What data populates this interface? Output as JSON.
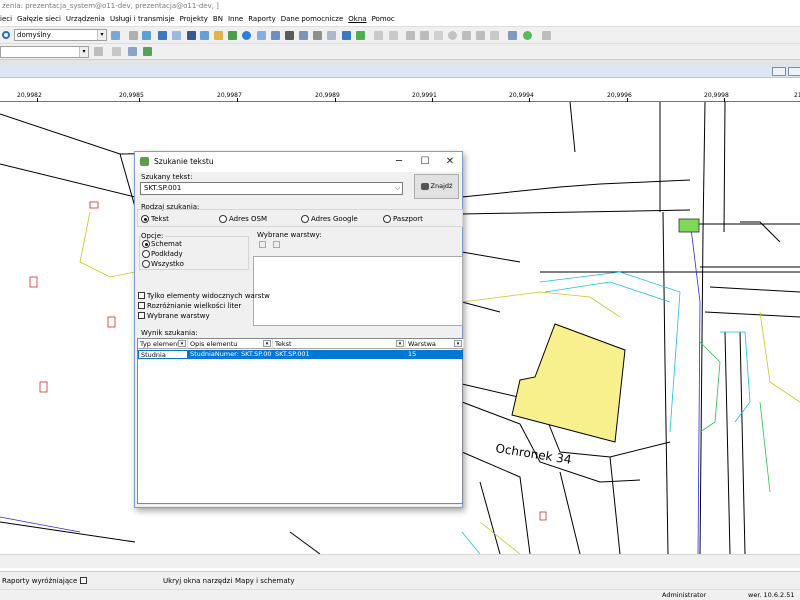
{
  "window": {
    "title": "zenia: prezentacja_system@o11-dev, prezentacja@o11-dev, ]"
  },
  "menu": [
    "ieci",
    "Gałęzie sieci",
    "Urządzenia",
    "Usługi i transmisje",
    "Projekty",
    "BN",
    "Inne",
    "Raporty",
    "Dane pomocnicze",
    "Okna",
    "Pomoc"
  ],
  "toolbar": {
    "view_combo": "domyślny",
    "view_combo_arrow": "▾",
    "small_combo_arrow": "▾"
  },
  "ruler": {
    "labels": [
      "20,9982",
      "20,9985",
      "20,9987",
      "20,9989",
      "20,9991",
      "20,9994",
      "20,9996",
      "20,9998",
      "21"
    ]
  },
  "map": {
    "street_label": "Ochronek 34"
  },
  "dialog": {
    "title": "Szukanie tekstu",
    "search_label": "Szukany tekst:",
    "search_value": "SKT.SP.001",
    "search_arrow": "⌵",
    "find_button": "Znajdź",
    "search_type_label": "Rodzaj szukania:",
    "search_types": [
      {
        "label": "Tekst",
        "selected": true
      },
      {
        "label": "Adres OSM",
        "selected": false
      },
      {
        "label": "Adres Google",
        "selected": false
      },
      {
        "label": "Paszport",
        "selected": false
      }
    ],
    "options_label": "Opcje:",
    "options": [
      {
        "label": "Schemat",
        "selected": true
      },
      {
        "label": "Podkłady",
        "selected": false
      },
      {
        "label": "Wszystko",
        "selected": false
      }
    ],
    "layers_label": "Wybrane warstwy:",
    "checkboxes": [
      {
        "label": "Tylko elementy widocznych warstw",
        "checked": false
      },
      {
        "label": "Rozróżnianie wielkości liter",
        "checked": false
      },
      {
        "label": "Wybrane warstwy",
        "checked": false
      }
    ],
    "results_label": "Wynik szukania:",
    "columns": [
      "Typ elementu",
      "Opis elementu",
      "Tekst",
      "Warstwa"
    ],
    "rows": [
      [
        "Studnia",
        "StudniaNumer: SKT.SP.00",
        "SKT.SP.001",
        "15"
      ]
    ]
  },
  "bottom": {
    "reports": "Raporty wyróżniające",
    "reports_arrow": "▾",
    "hide_tools": "Ukryj okna narzędzi",
    "maps": "Mapy i schematy"
  },
  "status": {
    "user": "Administrator",
    "version": "wer. 10.6.2.51"
  },
  "colors": {
    "building": "#f7f08c",
    "highlight": "#7ed957",
    "selection": "#0078d7"
  }
}
